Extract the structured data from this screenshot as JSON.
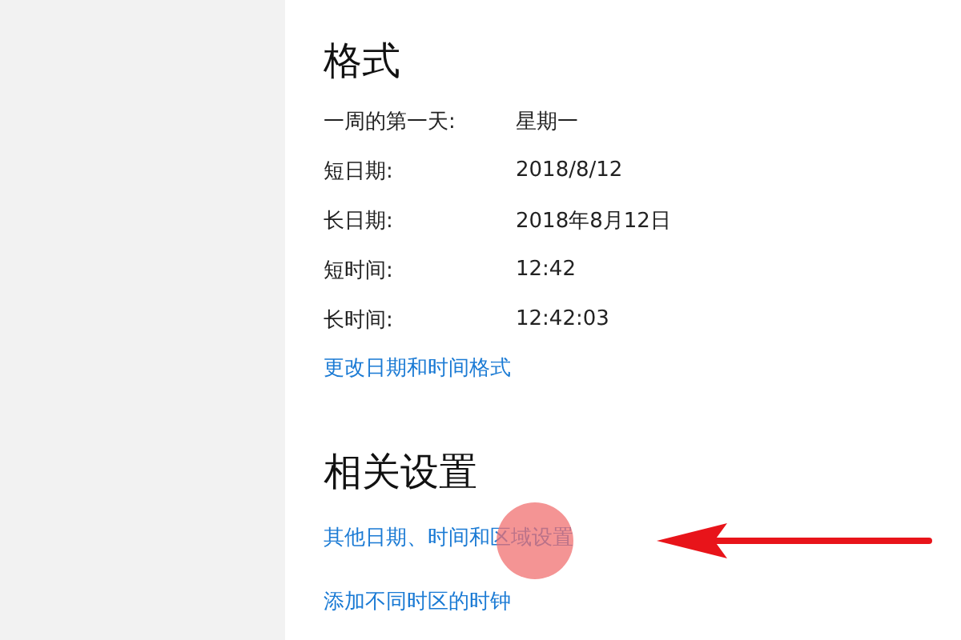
{
  "format": {
    "title": "格式",
    "rows": [
      {
        "label": "一周的第一天:",
        "value": "星期一"
      },
      {
        "label": "短日期:",
        "value": "2018/8/12"
      },
      {
        "label": "长日期:",
        "value": "2018年8月12日"
      },
      {
        "label": "短时间:",
        "value": "12:42"
      },
      {
        "label": "长时间:",
        "value": "12:42:03"
      }
    ],
    "link": "更改日期和时间格式"
  },
  "related": {
    "title": "相关设置",
    "links": [
      "其他日期、时间和区域设置",
      "添加不同时区的时钟"
    ]
  }
}
